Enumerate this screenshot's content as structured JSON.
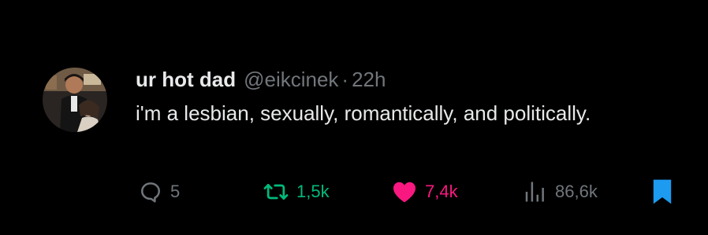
{
  "tweet": {
    "author_name": "ur hot dad",
    "handle": "@eikcinek",
    "separator": "·",
    "time": "22h",
    "text": "i'm a lesbian, sexually, romantically, and politically.",
    "avatar_icon": "profile-photo",
    "actions": {
      "reply_count": "5",
      "repost_count": "1,5k",
      "like_count": "7,4k",
      "view_count": "86,6k"
    },
    "state": {
      "liked": true,
      "reposted": true,
      "bookmarked": true
    }
  },
  "colors": {
    "background": "#000000",
    "text": "#e7e9ea",
    "muted": "#71767b",
    "repost": "#00ba7c",
    "like": "#f91880",
    "bookmark": "#1d9bf0"
  },
  "icons": {
    "reply": "speech-bubble-icon",
    "repost": "repost-arrows-icon",
    "like": "heart-filled-icon",
    "views": "bar-chart-icon",
    "bookmark": "bookmark-filled-icon"
  }
}
